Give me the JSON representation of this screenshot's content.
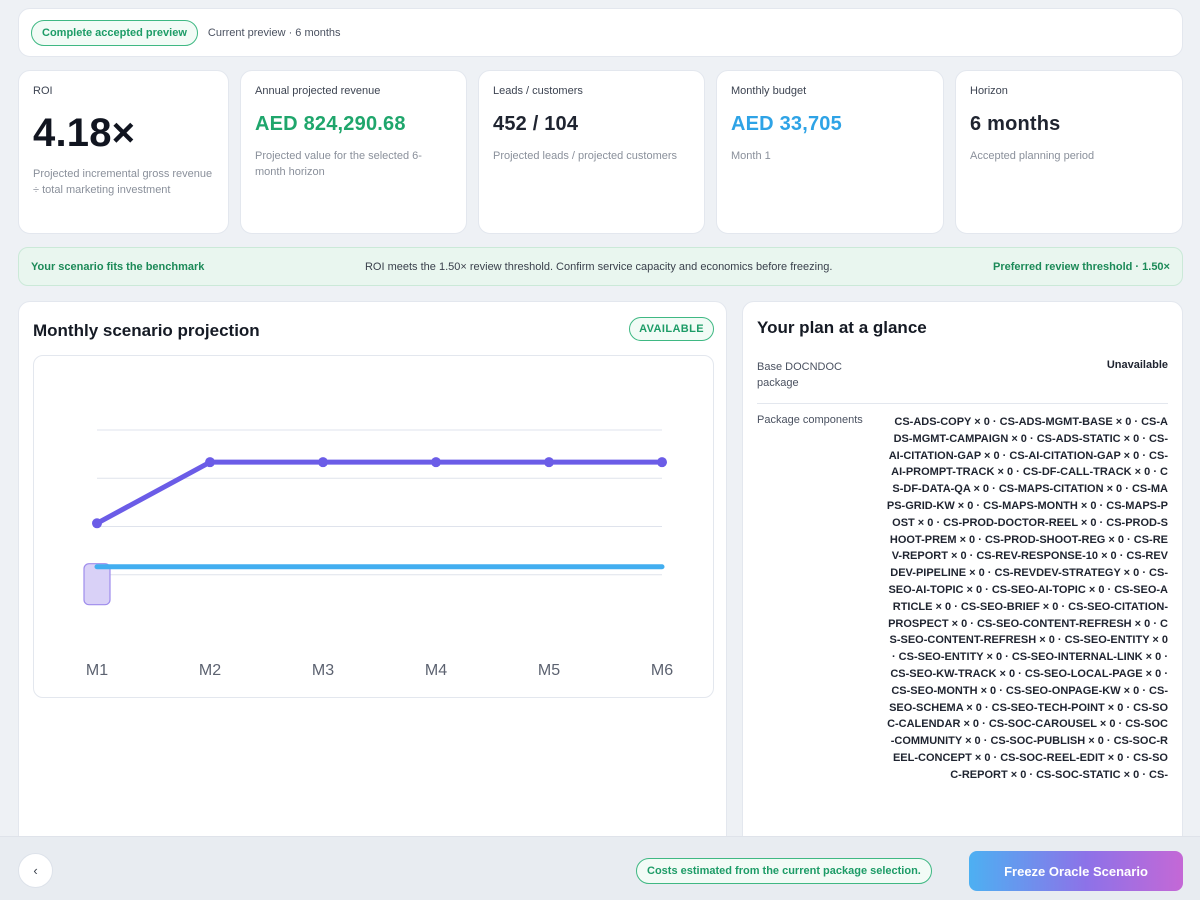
{
  "topbar": {
    "badge": "Complete accepted preview",
    "current": "Current preview · 6 months"
  },
  "kpis": [
    {
      "label": "ROI",
      "value": "4.18×",
      "desc": "Projected incremental gross revenue ÷ total marketing investment"
    },
    {
      "label": "Annual projected revenue",
      "value": "AED 824,290.68",
      "desc": "Projected value for the selected 6-month horizon"
    },
    {
      "label": "Leads / customers",
      "value": "452 / 104",
      "desc": "Projected leads / projected customers"
    },
    {
      "label": "Monthly budget",
      "value": "AED 33,705",
      "desc": "Month 1"
    },
    {
      "label": "Horizon",
      "value": "6 months",
      "desc": "Accepted planning period"
    }
  ],
  "banner": {
    "left": "Your scenario fits the benchmark",
    "middle": "ROI meets the 1.50× review threshold. Confirm service capacity and economics before freezing.",
    "right": "Preferred review threshold · 1.50×"
  },
  "projection": {
    "title": "Monthly scenario projection",
    "status": "AVAILABLE"
  },
  "chart_data": {
    "type": "line",
    "categories": [
      "M1",
      "M2",
      "M3",
      "M4",
      "M5",
      "M6"
    ],
    "series": [
      {
        "values": [
          0.62,
          1.0,
          1.0,
          1.0,
          1.0,
          1.0
        ],
        "color": "#6b5ce7"
      },
      {
        "values": [
          0.35,
          0.35,
          0.35,
          0.35,
          0.35,
          0.35
        ],
        "color": "#42aef0"
      }
    ],
    "ylim": [
      0,
      1.2
    ],
    "grid": true
  },
  "plan": {
    "title": "Your plan at a glance",
    "base_label": "Base DOCNDOC package",
    "base_value": "Unavailable",
    "components_label": "Package components",
    "components_value": "CS-ADS-COPY × 0 · CS-ADS-MGMT-BASE × 0 · CS-ADS-MGMT-CAMPAIGN × 0 · CS-ADS-STATIC × 0 · CS-AI-CITATION-GAP × 0 · CS-AI-CITATION-GAP × 0 · CS-AI-PROMPT-TRACK × 0 · CS-DF-CALL-TRACK × 0 · CS-DF-DATA-QA × 0 · CS-MAPS-CITATION × 0 · CS-MAPS-GRID-KW × 0 · CS-MAPS-MONTH × 0 · CS-MAPS-POST × 0 · CS-PROD-DOCTOR-REEL × 0 · CS-PROD-SHOOT-PREM × 0 · CS-PROD-SHOOT-REG × 0 · CS-REV-REPORT × 0 · CS-REV-RESPONSE-10 × 0 · CS-REVDEV-PIPELINE × 0 · CS-REVDEV-STRATEGY × 0 · CS-SEO-AI-TOPIC × 0 · CS-SEO-AI-TOPIC × 0 · CS-SEO-ARTICLE × 0 · CS-SEO-BRIEF × 0 · CS-SEO-CITATION-PROSPECT × 0 · CS-SEO-CONTENT-REFRESH × 0 · CS-SEO-CONTENT-REFRESH × 0 · CS-SEO-ENTITY × 0 · CS-SEO-ENTITY × 0 · CS-SEO-INTERNAL-LINK × 0 · CS-SEO-KW-TRACK × 0 · CS-SEO-LOCAL-PAGE × 0 · CS-SEO-MONTH × 0 · CS-SEO-ONPAGE-KW × 0 · CS-SEO-SCHEMA × 0 · CS-SEO-TECH-POINT × 0 · CS-SOC-CALENDAR × 0 · CS-SOC-CAROUSEL × 0 · CS-SOC-COMMUNITY × 0 · CS-SOC-PUBLISH × 0 · CS-SOC-REEL-CONCEPT × 0 · CS-SOC-REEL-EDIT × 0 · CS-SOC-REPORT × 0 · CS-SOC-STATIC × 0 · CS-"
  },
  "footer": {
    "back": "‹",
    "note": "Costs estimated from the current package selection.",
    "freeze": "Freeze Oracle Scenario"
  }
}
